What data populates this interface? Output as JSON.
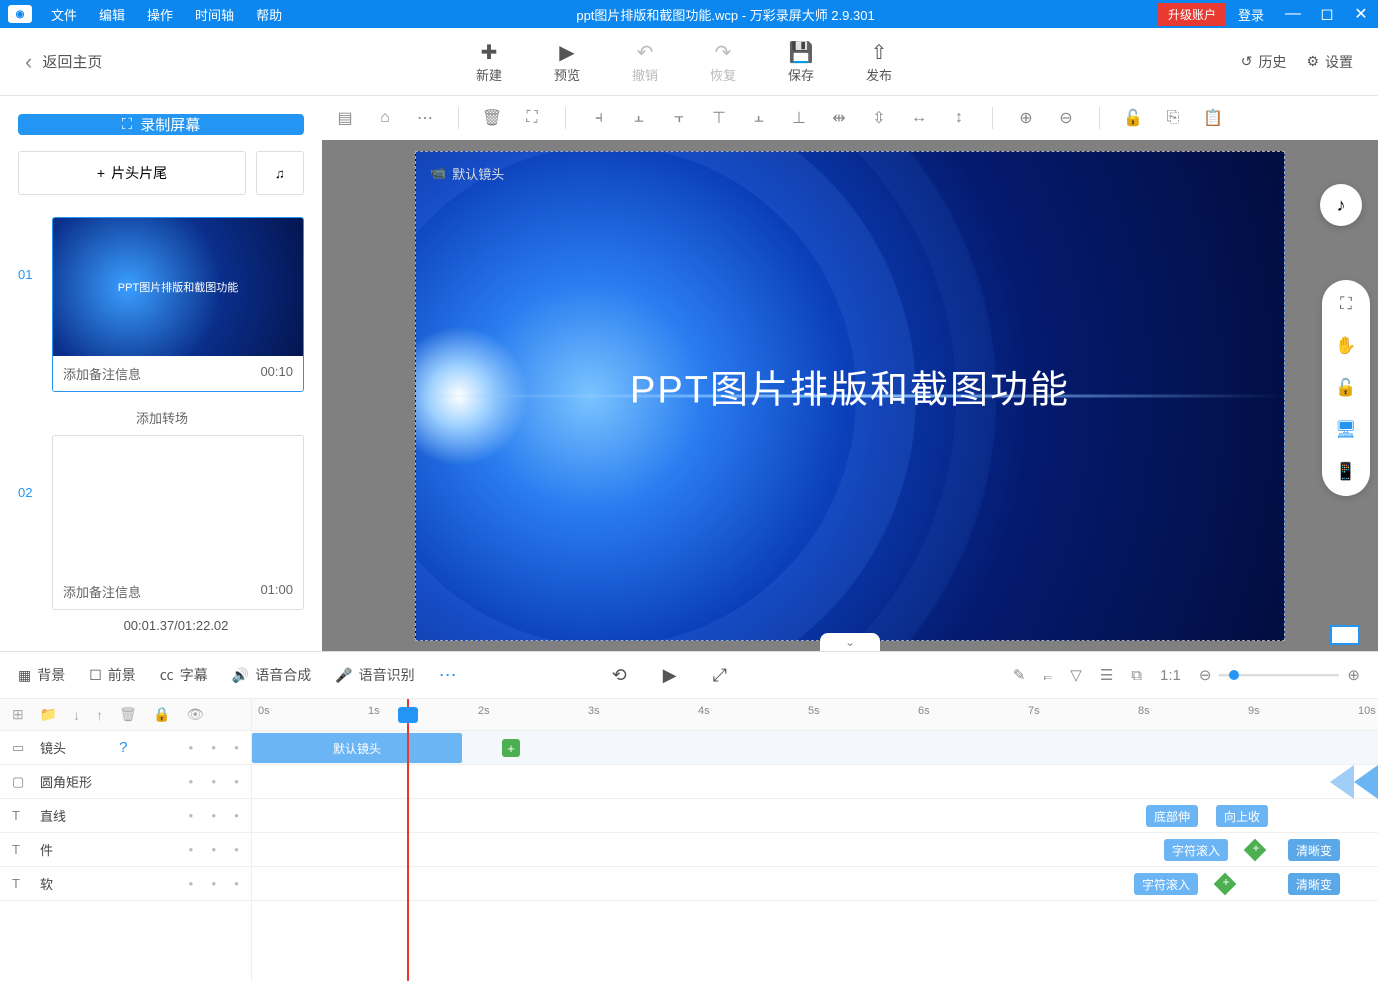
{
  "titlebar": {
    "menus": [
      "文件",
      "编辑",
      "操作",
      "时间轴",
      "帮助"
    ],
    "title": "ppt图片排版和截图功能.wcp - 万彩录屏大师 2.9.301",
    "upgrade": "升级账户",
    "login": "登录"
  },
  "toolbar": {
    "back": "返回主页",
    "items": [
      {
        "k": "new",
        "l": "新建",
        "i": "✚"
      },
      {
        "k": "preview",
        "l": "预览",
        "i": "▶"
      },
      {
        "k": "undo",
        "l": "撤销",
        "i": "↶",
        "d": true
      },
      {
        "k": "redo",
        "l": "恢复",
        "i": "↷",
        "d": true
      },
      {
        "k": "save",
        "l": "保存",
        "i": "💾"
      },
      {
        "k": "publish",
        "l": "发布",
        "i": "⇧"
      }
    ],
    "history": "历史",
    "settings": "设置"
  },
  "sidebar": {
    "record": "录制屏幕",
    "clips": "片头片尾",
    "slides": [
      {
        "num": "01",
        "title": "PPT图片排版和截图功能",
        "note": "添加备注信息",
        "dur": "00:10"
      },
      {
        "num": "02",
        "title": "",
        "note": "添加备注信息",
        "dur": "01:00"
      }
    ],
    "addtrans": "添加转场",
    "timecode": "00:01.37/01:22.02"
  },
  "canvas": {
    "camlabel": "默认镜头",
    "headline": "PPT图片排版和截图功能"
  },
  "bottom": {
    "tabs": [
      {
        "i": "▦",
        "l": "背景"
      },
      {
        "i": "☐",
        "l": "前景"
      },
      {
        "i": "㏄",
        "l": "字幕"
      },
      {
        "i": "🔊",
        "l": "语音合成"
      },
      {
        "i": "🎤",
        "l": "语音识别"
      }
    ]
  },
  "timeline": {
    "ticks": [
      "0s",
      "1s",
      "2s",
      "3s",
      "4s",
      "5s",
      "6s",
      "7s",
      "8s",
      "9s",
      "10s"
    ],
    "tracks": [
      {
        "i": "▭",
        "l": "镜头",
        "help": true
      },
      {
        "i": "▢",
        "l": "圆角矩形"
      },
      {
        "i": "T",
        "l": "直线"
      },
      {
        "i": "T",
        "l": "件"
      },
      {
        "i": "T",
        "l": "软"
      }
    ],
    "shotclip": "默认镜头",
    "tags": {
      "t3": [
        "底部伸",
        "向上收"
      ],
      "t4": [
        "字符滚入",
        "清晰变"
      ],
      "t5": [
        "字符滚入",
        "清晰变"
      ]
    }
  }
}
